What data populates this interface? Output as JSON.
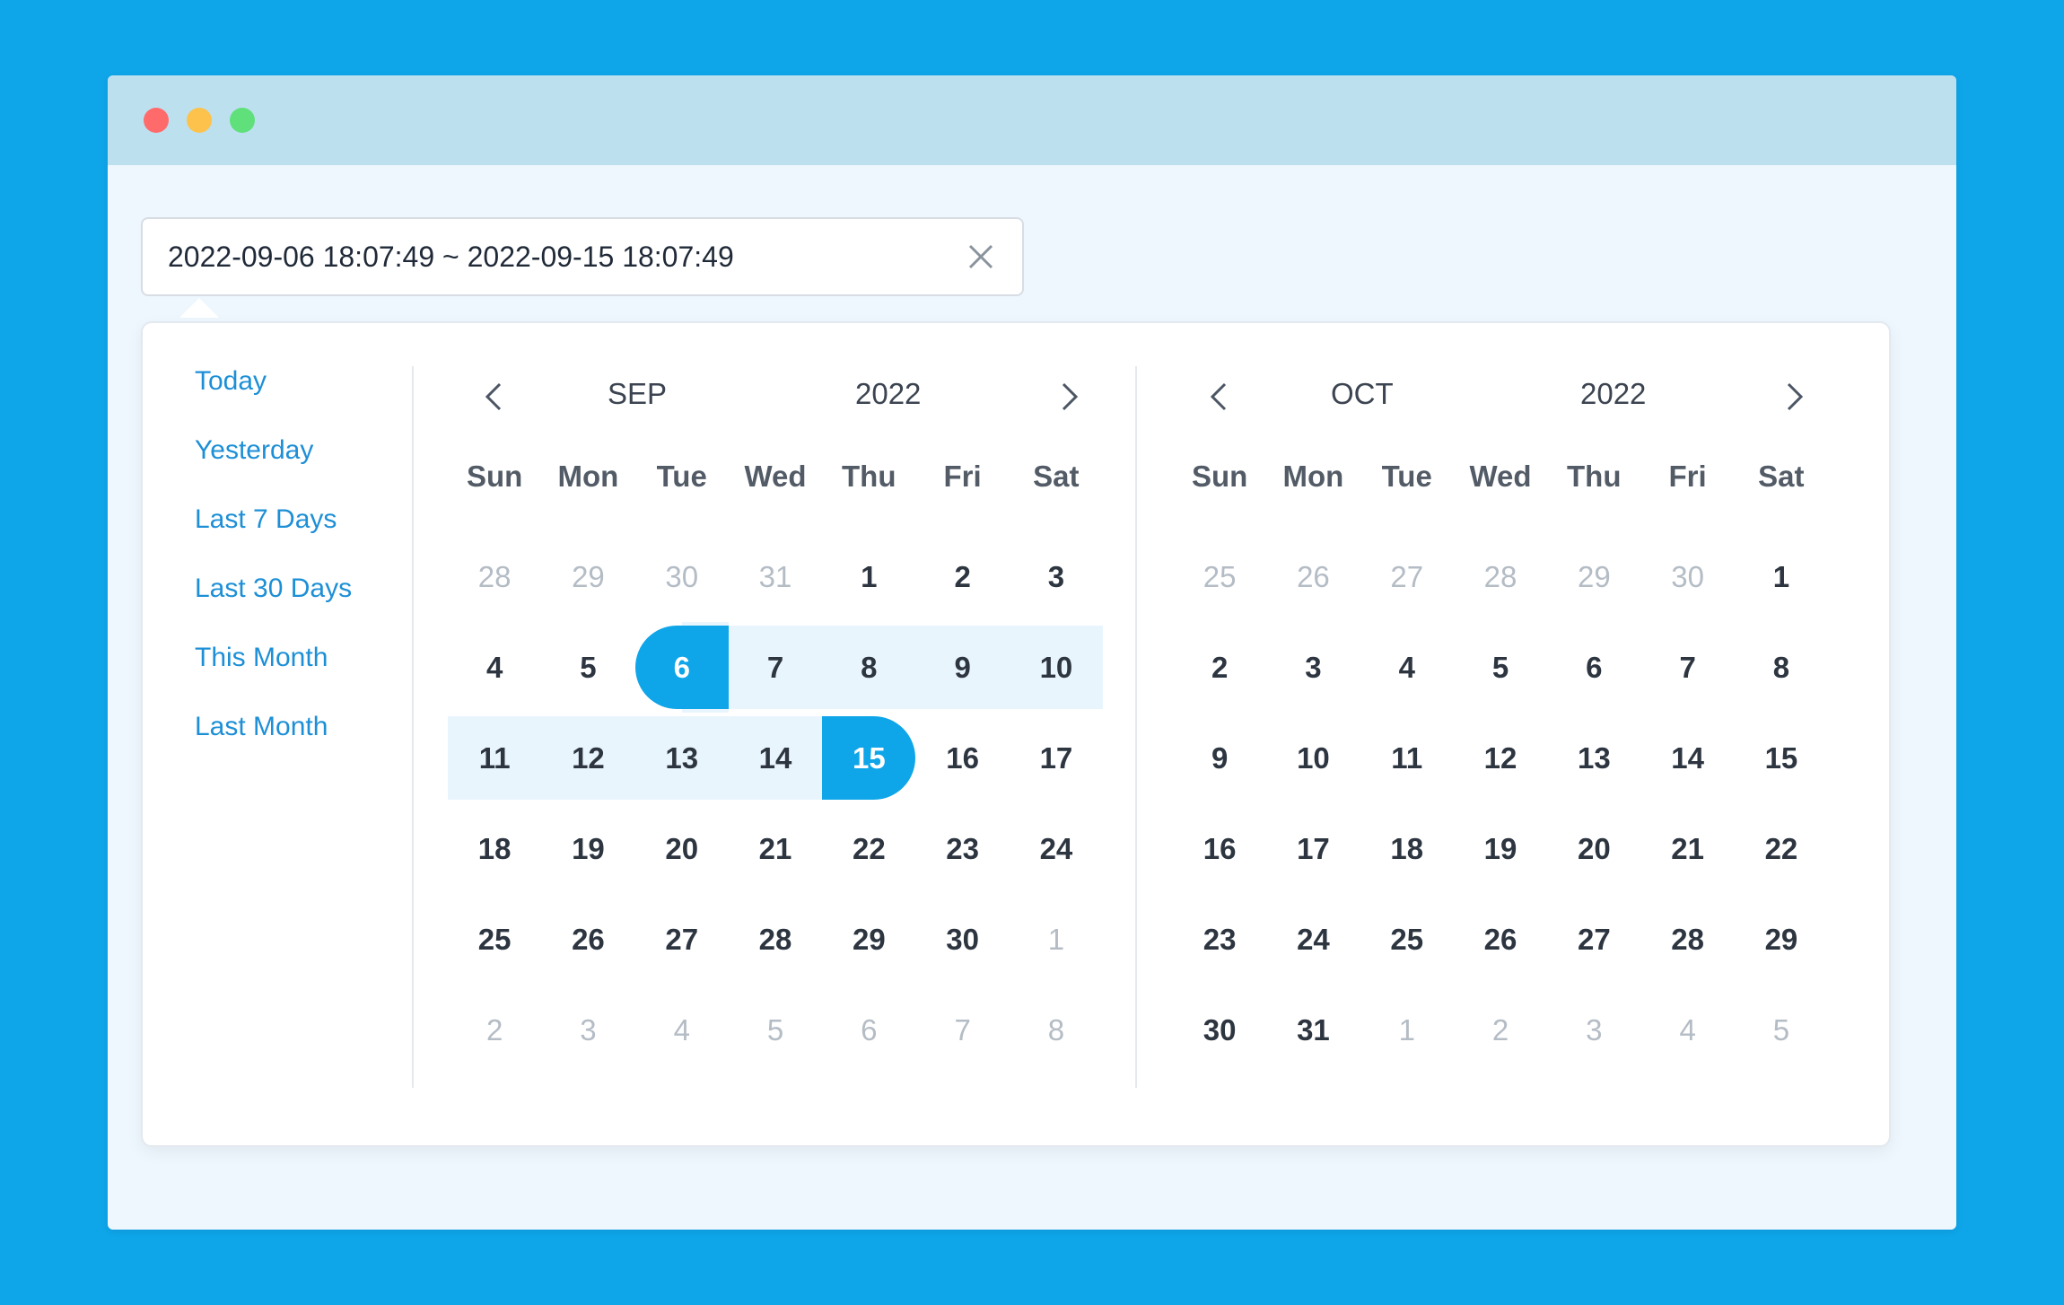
{
  "window": {
    "traffic_lights": [
      "close",
      "minimize",
      "maximize"
    ]
  },
  "range_input": {
    "value": "2022-09-06 18:07:49 ~ 2022-09-15 18:07:49",
    "clear_icon": "close-icon"
  },
  "shortcuts": [
    "Today",
    "Yesterday",
    "Last 7 Days",
    "Last 30 Days",
    "This Month",
    "Last Month"
  ],
  "weekdays": [
    "Sun",
    "Mon",
    "Tue",
    "Wed",
    "Thu",
    "Fri",
    "Sat"
  ],
  "calendars": [
    {
      "month": "SEP",
      "year": "2022",
      "days": [
        {
          "d": "28",
          "t": "other"
        },
        {
          "d": "29",
          "t": "other"
        },
        {
          "d": "30",
          "t": "other"
        },
        {
          "d": "31",
          "t": "other"
        },
        {
          "d": "1",
          "t": ""
        },
        {
          "d": "2",
          "t": ""
        },
        {
          "d": "3",
          "t": ""
        },
        {
          "d": "4",
          "t": ""
        },
        {
          "d": "5",
          "t": ""
        },
        {
          "d": "6",
          "t": "start"
        },
        {
          "d": "7",
          "t": "in-range"
        },
        {
          "d": "8",
          "t": "in-range"
        },
        {
          "d": "9",
          "t": "in-range"
        },
        {
          "d": "10",
          "t": "in-range"
        },
        {
          "d": "11",
          "t": "in-range"
        },
        {
          "d": "12",
          "t": "in-range"
        },
        {
          "d": "13",
          "t": "in-range"
        },
        {
          "d": "14",
          "t": "in-range"
        },
        {
          "d": "15",
          "t": "end"
        },
        {
          "d": "16",
          "t": ""
        },
        {
          "d": "17",
          "t": ""
        },
        {
          "d": "18",
          "t": ""
        },
        {
          "d": "19",
          "t": ""
        },
        {
          "d": "20",
          "t": ""
        },
        {
          "d": "21",
          "t": ""
        },
        {
          "d": "22",
          "t": ""
        },
        {
          "d": "23",
          "t": ""
        },
        {
          "d": "24",
          "t": ""
        },
        {
          "d": "25",
          "t": ""
        },
        {
          "d": "26",
          "t": ""
        },
        {
          "d": "27",
          "t": ""
        },
        {
          "d": "28",
          "t": ""
        },
        {
          "d": "29",
          "t": ""
        },
        {
          "d": "30",
          "t": ""
        },
        {
          "d": "1",
          "t": "other"
        },
        {
          "d": "2",
          "t": "other"
        },
        {
          "d": "3",
          "t": "other"
        },
        {
          "d": "4",
          "t": "other"
        },
        {
          "d": "5",
          "t": "other"
        },
        {
          "d": "6",
          "t": "other"
        },
        {
          "d": "7",
          "t": "other"
        },
        {
          "d": "8",
          "t": "other"
        }
      ]
    },
    {
      "month": "OCT",
      "year": "2022",
      "days": [
        {
          "d": "25",
          "t": "other"
        },
        {
          "d": "26",
          "t": "other"
        },
        {
          "d": "27",
          "t": "other"
        },
        {
          "d": "28",
          "t": "other"
        },
        {
          "d": "29",
          "t": "other"
        },
        {
          "d": "30",
          "t": "other"
        },
        {
          "d": "1",
          "t": ""
        },
        {
          "d": "2",
          "t": ""
        },
        {
          "d": "3",
          "t": ""
        },
        {
          "d": "4",
          "t": ""
        },
        {
          "d": "5",
          "t": ""
        },
        {
          "d": "6",
          "t": ""
        },
        {
          "d": "7",
          "t": ""
        },
        {
          "d": "8",
          "t": ""
        },
        {
          "d": "9",
          "t": ""
        },
        {
          "d": "10",
          "t": ""
        },
        {
          "d": "11",
          "t": ""
        },
        {
          "d": "12",
          "t": ""
        },
        {
          "d": "13",
          "t": ""
        },
        {
          "d": "14",
          "t": ""
        },
        {
          "d": "15",
          "t": ""
        },
        {
          "d": "16",
          "t": ""
        },
        {
          "d": "17",
          "t": ""
        },
        {
          "d": "18",
          "t": ""
        },
        {
          "d": "19",
          "t": ""
        },
        {
          "d": "20",
          "t": ""
        },
        {
          "d": "21",
          "t": ""
        },
        {
          "d": "22",
          "t": ""
        },
        {
          "d": "23",
          "t": ""
        },
        {
          "d": "24",
          "t": ""
        },
        {
          "d": "25",
          "t": ""
        },
        {
          "d": "26",
          "t": ""
        },
        {
          "d": "27",
          "t": ""
        },
        {
          "d": "28",
          "t": ""
        },
        {
          "d": "29",
          "t": ""
        },
        {
          "d": "30",
          "t": ""
        },
        {
          "d": "31",
          "t": ""
        },
        {
          "d": "1",
          "t": "other"
        },
        {
          "d": "2",
          "t": "other"
        },
        {
          "d": "3",
          "t": "other"
        },
        {
          "d": "4",
          "t": "other"
        },
        {
          "d": "5",
          "t": "other"
        }
      ]
    }
  ],
  "colors": {
    "background": "#0ea5e9",
    "accent": "#0ea5e9",
    "range_fill": "#e9f5fd",
    "link": "#1d8fd6"
  }
}
